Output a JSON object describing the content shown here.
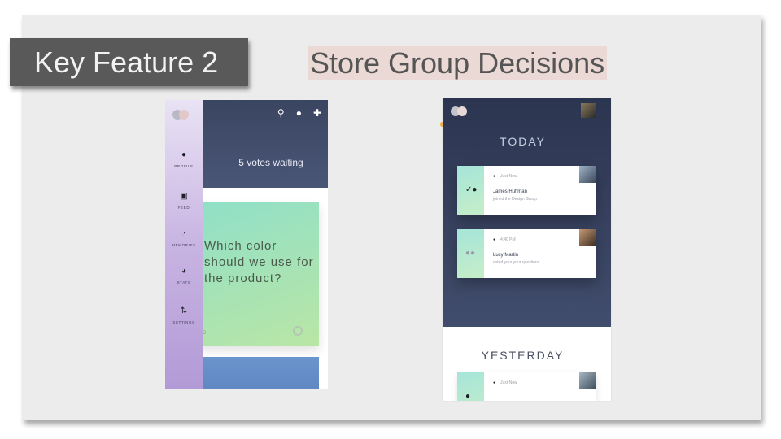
{
  "slide": {
    "feature_label": "Key Feature 2",
    "headline": "Store Group Decisions"
  },
  "phone_feed": {
    "header_icons": [
      "search-icon",
      "bell-icon",
      "plus-icon"
    ],
    "votes_waiting": "5 votes waiting",
    "question": "Which color should we use for the product?",
    "card_footer": "D",
    "sidebar": [
      {
        "icon": "person-icon",
        "label": "PROFILE"
      },
      {
        "icon": "feed-icon",
        "label": "FEED"
      },
      {
        "icon": "clock-icon",
        "label": "MEMORIES"
      },
      {
        "icon": "pie-chart-icon",
        "label": "STATS"
      },
      {
        "icon": "sliders-icon",
        "label": "SETTINGS"
      }
    ]
  },
  "phone_activity": {
    "today": "TODAY",
    "yesterday": "YESTERDAY",
    "notifications": [
      {
        "time": "Just Now",
        "name": "James Huffman",
        "text": "joined the Design Group"
      },
      {
        "time": "4:40 PM",
        "name": "Lucy Martin",
        "text": "voted your your questions"
      },
      {
        "time": "Just Now",
        "name": "",
        "text": ""
      }
    ]
  },
  "colors": {
    "feature_box": "#595959",
    "headline_highlight": "#ead9d5",
    "phone_dark": "#3a4561",
    "sidebar": "#c8b4e2",
    "card_green": "#a9e3b3"
  }
}
